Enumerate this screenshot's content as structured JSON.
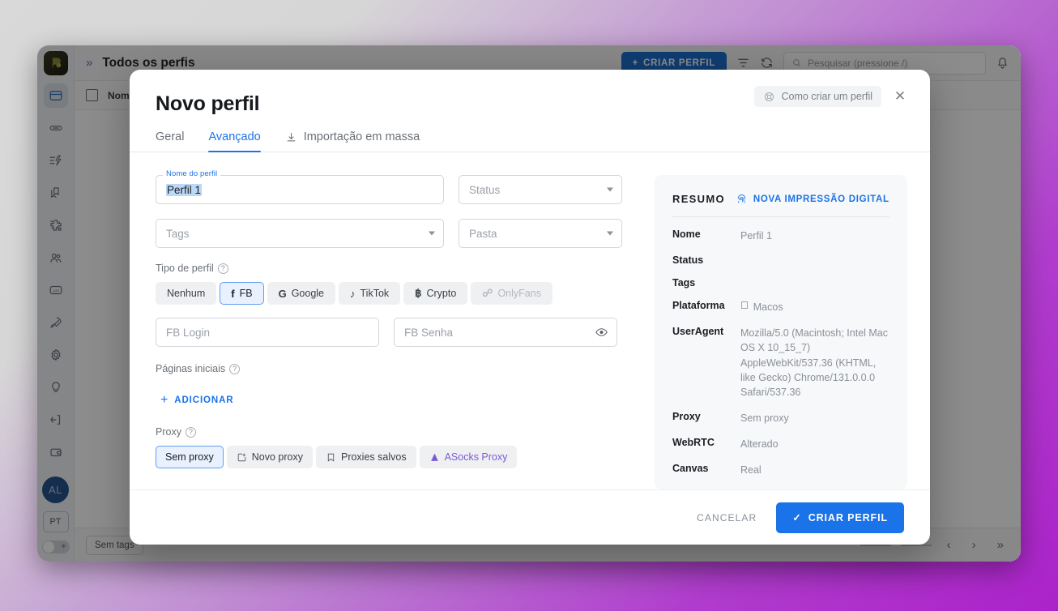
{
  "app": {
    "title": "Todos os perfis",
    "expand_icon": "chevron-double-right-icon",
    "create_profile_button": "CRIAR PERFIL",
    "filter_icon": "filter-icon",
    "refresh_icon": "refresh-icon",
    "search_placeholder": "Pesquisar (pressione /)",
    "bell_icon": "bell-icon",
    "table_header_first_col": "Nom",
    "footer_tag": "Sem tags",
    "sidebar": {
      "logo": "app-logo",
      "items": [
        {
          "icon": "browser-profiles-icon",
          "active": true
        },
        {
          "icon": "link-icon",
          "active": false
        },
        {
          "icon": "automation-icon",
          "active": false
        },
        {
          "icon": "copies-icon",
          "active": false
        },
        {
          "icon": "extensions-icon",
          "active": false
        },
        {
          "icon": "team-icon",
          "active": false
        },
        {
          "icon": "api-icon",
          "active": false
        },
        {
          "icon": "rocket-icon",
          "active": false
        },
        {
          "icon": "gear-icon",
          "active": false
        },
        {
          "icon": "bulb-icon",
          "active": false
        },
        {
          "icon": "logout-icon",
          "active": false
        },
        {
          "icon": "wallet-icon",
          "active": false
        }
      ],
      "avatar_initials": "AL",
      "language": "PT"
    }
  },
  "modal": {
    "title": "Novo perfil",
    "help_chip": "Como criar um perfil",
    "help_icon": "lifebuoy-icon",
    "close_icon": "close-icon",
    "tabs": [
      {
        "label": "Geral",
        "active": false,
        "icon": null
      },
      {
        "label": "Avançado",
        "active": true,
        "icon": null
      },
      {
        "label": "Importação em massa",
        "active": false,
        "icon": "download-icon"
      }
    ],
    "form": {
      "profile_name_label": "Nome do perfil",
      "profile_name_value": "Perfil 1",
      "status_placeholder": "Status",
      "tags_placeholder": "Tags",
      "folder_placeholder": "Pasta",
      "profile_type_label": "Tipo de perfil",
      "profile_types": [
        {
          "label": "Nenhum",
          "icon": null,
          "selected": false,
          "disabled": false
        },
        {
          "label": "FB",
          "icon": "facebook-icon",
          "selected": true,
          "disabled": false
        },
        {
          "label": "Google",
          "icon": "google-icon",
          "selected": false,
          "disabled": false
        },
        {
          "label": "TikTok",
          "icon": "tiktok-icon",
          "selected": false,
          "disabled": false
        },
        {
          "label": "Crypto",
          "icon": "bitcoin-icon",
          "selected": false,
          "disabled": false
        },
        {
          "label": "OnlyFans",
          "icon": "onlyfans-icon",
          "selected": false,
          "disabled": true
        }
      ],
      "fb_login_placeholder": "FB Login",
      "fb_password_placeholder": "FB Senha",
      "password_reveal_icon": "eye-icon",
      "home_pages_label": "Páginas iniciais",
      "add_button": "ADICIONAR",
      "proxy_label": "Proxy",
      "proxy_options": [
        {
          "label": "Sem proxy",
          "icon": null,
          "selected": true,
          "accent": false
        },
        {
          "label": "Novo proxy",
          "icon": "new-proxy-icon",
          "selected": false,
          "accent": false
        },
        {
          "label": "Proxies salvos",
          "icon": "bookmark-icon",
          "selected": false,
          "accent": false
        },
        {
          "label": "ASocks Proxy",
          "icon": "asocks-icon",
          "selected": false,
          "accent": true
        }
      ]
    },
    "summary": {
      "title": "RESUMO",
      "fingerprint_button": "NOVA IMPRESSÃO DIGITAL",
      "fingerprint_icon": "fingerprint-icon",
      "rows": [
        {
          "key": "Nome",
          "value": "Perfil 1",
          "icon": null
        },
        {
          "key": "Status",
          "value": "",
          "icon": null
        },
        {
          "key": "Tags",
          "value": "",
          "icon": null
        },
        {
          "key": "Plataforma",
          "value": "Macos",
          "icon": "apple-icon"
        },
        {
          "key": "UserAgent",
          "value": "Mozilla/5.0 (Macintosh; Intel Mac OS X 10_15_7) AppleWebKit/537.36 (KHTML, like Gecko) Chrome/131.0.0.0 Safari/537.36",
          "icon": null
        },
        {
          "key": "Proxy",
          "value": "Sem proxy",
          "icon": null
        },
        {
          "key": "WebRTC",
          "value": "Alterado",
          "icon": null
        },
        {
          "key": "Canvas",
          "value": "Real",
          "icon": null
        }
      ]
    },
    "footer": {
      "cancel": "CANCELAR",
      "create": "CRIAR PERFIL",
      "create_icon": "check-icon"
    }
  },
  "colors": {
    "accent_blue": "#1a73e8",
    "asocks_purple": "#7c5cd6",
    "avatar_blue": "#27548f",
    "background_gradient_start": "#d9d9d9",
    "background_gradient_end": "#ab22c9"
  }
}
